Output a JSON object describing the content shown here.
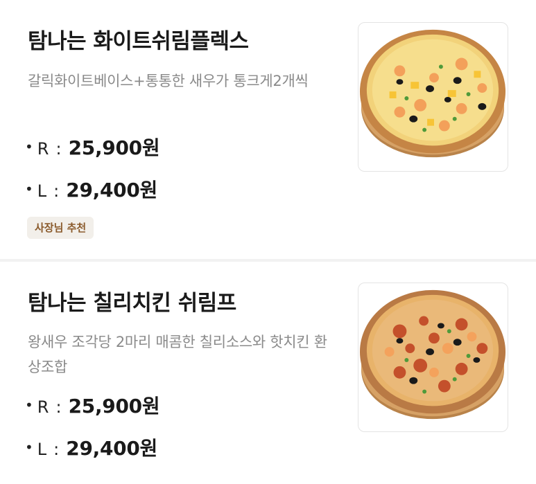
{
  "items": [
    {
      "title": "탐나는 화이트쉬림플렉스",
      "description": "갈릭화이트베이스+통통한 새우가 통크게2개씩",
      "prices": [
        {
          "bullet": "•",
          "size": "R",
          "colon": ":",
          "amount": "25,900원"
        },
        {
          "bullet": "•",
          "size": "L",
          "colon": ":",
          "amount": "29,400원"
        }
      ],
      "badge": "사장님 추천",
      "image_icon": "pizza-image"
    },
    {
      "title": "탐나는 칠리치킨 쉬림프",
      "description": "왕새우 조각당 2마리 매콤한 칠리소스와 핫치킨 환상조합",
      "prices": [
        {
          "bullet": "•",
          "size": "R",
          "colon": ":",
          "amount": "25,900원"
        },
        {
          "bullet": "•",
          "size": "L",
          "colon": ":",
          "amount": "29,400원"
        }
      ],
      "image_icon": "pizza-image"
    }
  ],
  "colors": {
    "background": "#f2f2f2",
    "card": "#ffffff",
    "badge_bg": "#f2efea",
    "badge_text": "#8a5a2b",
    "desc_text": "#8a8a8a"
  }
}
